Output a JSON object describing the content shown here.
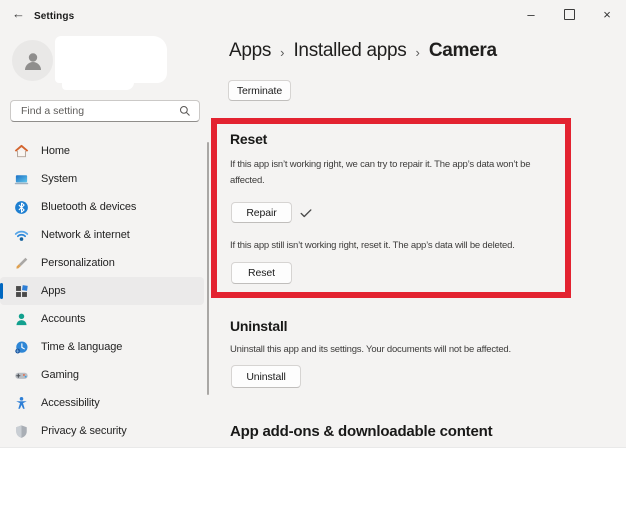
{
  "titlebar": {
    "back_glyph": "←",
    "title": "Settings",
    "minimize_glyph": "–",
    "close_glyph": "×"
  },
  "sidebar": {
    "search_placeholder": "Find a setting",
    "items": [
      {
        "label": "Home",
        "icon": "home-icon",
        "selected": false
      },
      {
        "label": "System",
        "icon": "system-icon",
        "selected": false
      },
      {
        "label": "Bluetooth & devices",
        "icon": "bluetooth-icon",
        "selected": false
      },
      {
        "label": "Network & internet",
        "icon": "network-icon",
        "selected": false
      },
      {
        "label": "Personalization",
        "icon": "personalization-icon",
        "selected": false
      },
      {
        "label": "Apps",
        "icon": "apps-icon",
        "selected": true
      },
      {
        "label": "Accounts",
        "icon": "accounts-icon",
        "selected": false
      },
      {
        "label": "Time & language",
        "icon": "time-language-icon",
        "selected": false
      },
      {
        "label": "Gaming",
        "icon": "gaming-icon",
        "selected": false
      },
      {
        "label": "Accessibility",
        "icon": "accessibility-icon",
        "selected": false
      },
      {
        "label": "Privacy & security",
        "icon": "privacy-security-icon",
        "selected": false
      }
    ]
  },
  "breadcrumb": {
    "items": [
      "Apps",
      "Installed apps",
      "Camera"
    ],
    "separator": "›"
  },
  "content": {
    "terminate_button": "Terminate",
    "reset_section": {
      "title": "Reset",
      "repair_text": "If this app isn’t working right, we can try to repair it. The app’s data won’t be affected.",
      "repair_button": "Repair",
      "repair_status_icon": "checkmark",
      "reset_text": "If this app still isn’t working right, reset it. The app’s data will be deleted.",
      "reset_button": "Reset"
    },
    "uninstall_section": {
      "title": "Uninstall",
      "text": "Uninstall this app and its settings. Your documents will not be affected.",
      "uninstall_button": "Uninstall"
    },
    "addons_heading": "App add-ons & downloadable content"
  },
  "colors": {
    "accent": "#0067c0",
    "highlight_border": "#e32230",
    "window_background": "#f4f3f2"
  }
}
